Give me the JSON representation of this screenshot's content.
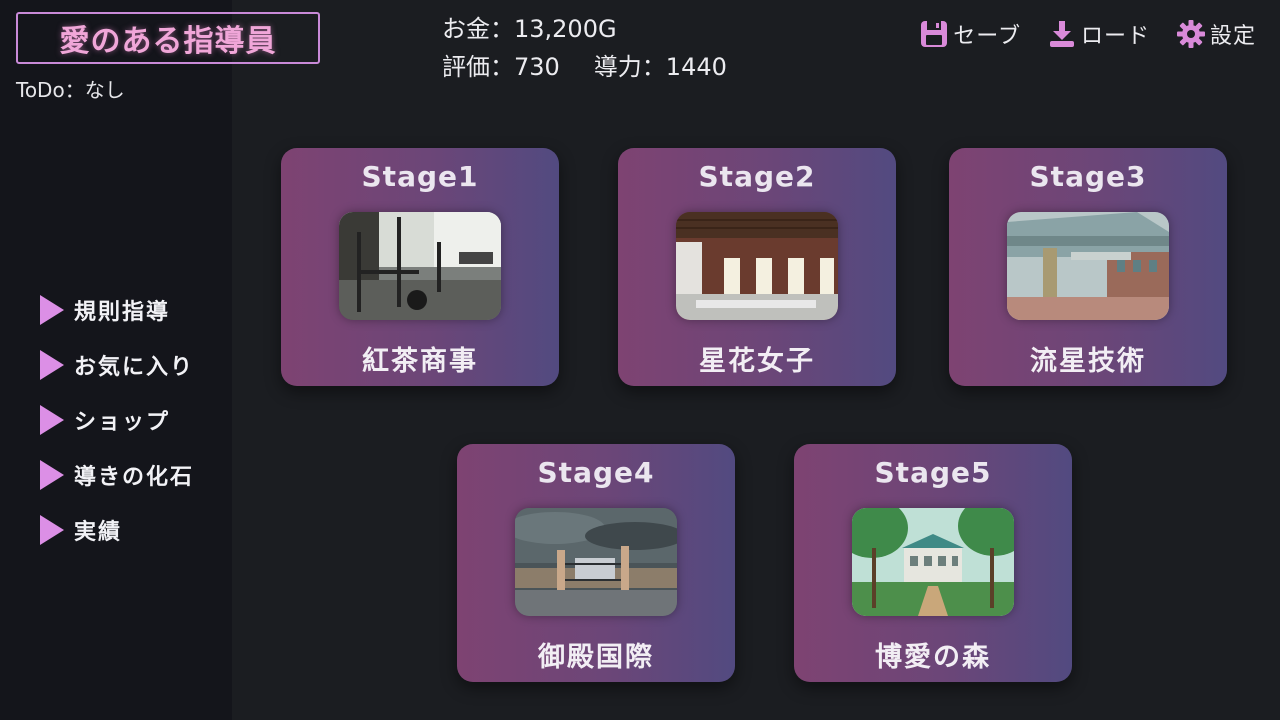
{
  "header": {
    "game_title": "愛のある指導員",
    "todo": "ToDo：なし",
    "money": "お金：13,200G",
    "rating": "評価：730",
    "guidance": "導力：1440"
  },
  "topbar": {
    "save_label": "セーブ",
    "load_label": "ロード",
    "settings_label": "設定"
  },
  "sidebar": {
    "items": [
      {
        "label": "規則指導"
      },
      {
        "label": "お気に入り"
      },
      {
        "label": "ショップ"
      },
      {
        "label": "導きの化石"
      },
      {
        "label": "実績"
      }
    ]
  },
  "stages": [
    {
      "stage": "Stage1",
      "name": "紅茶商事",
      "image": "gym-interior"
    },
    {
      "stage": "Stage2",
      "name": "星花女子",
      "image": "brick-hall"
    },
    {
      "stage": "Stage3",
      "name": "流星技術",
      "image": "building-entrance"
    },
    {
      "stage": "Stage4",
      "name": "御殿国際",
      "image": "gated-mansion"
    },
    {
      "stage": "Stage5",
      "name": "博愛の森",
      "image": "forest-school"
    }
  ],
  "colors": {
    "accent_pink": "#dc8fe6",
    "card_left": "#7e4372",
    "card_right": "#524a80",
    "background": "#1b1d21",
    "sidebar": "#14151b"
  }
}
